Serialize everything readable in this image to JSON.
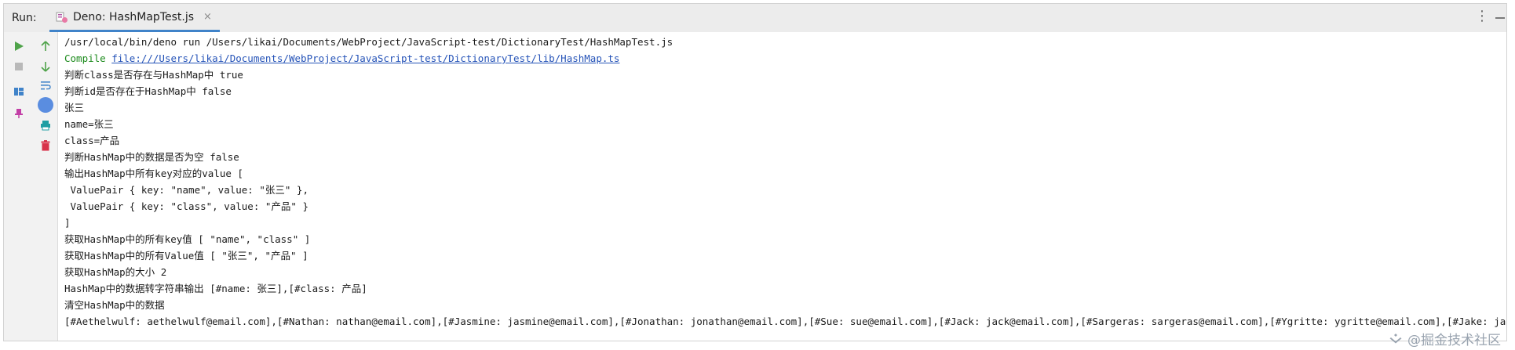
{
  "run_panel": {
    "label": "Run:",
    "tab_title": "Deno: HashMapTest.js",
    "tab_close": "×",
    "more_menu": "⋮"
  },
  "toolbar": {
    "left": [
      "run-icon",
      "stop-icon",
      "layout-icon",
      "pin-icon"
    ],
    "right": [
      "up-arrow-icon",
      "down-arrow-icon",
      "soft-wrap-icon",
      "scroll-to-end-icon",
      "print-icon",
      "trash-icon"
    ]
  },
  "console": {
    "command": "/usr/local/bin/deno run /Users/likai/Documents/WebProject/JavaScript-test/DictionaryTest/HashMapTest.js",
    "compile_prefix": "Compile ",
    "compile_link": "file:///Users/likai/Documents/WebProject/JavaScript-test/DictionaryTest/lib/HashMap.ts",
    "lines": [
      "判断class是否存在与HashMap中 true",
      "判断id是否存在于HashMap中 false",
      "张三",
      "name=张三",
      "class=产品",
      "判断HashMap中的数据是否为空 false",
      "输出HashMap中所有key对应的value [",
      " ValuePair { key: \"name\", value: \"张三\" },",
      " ValuePair { key: \"class\", value: \"产品\" }",
      "]",
      "获取HashMap中的所有key值 [ \"name\", \"class\" ]",
      "获取HashMap中的所有Value值 [ \"张三\", \"产品\" ]",
      "获取HashMap的大小 2",
      "HashMap中的数据转字符串输出 [#name: 张三],[#class: 产品]",
      "清空HashMap中的数据",
      "[#Aethelwulf: aethelwulf@email.com],[#Nathan: nathan@email.com],[#Jasmine: jasmine@email.com],[#Jonathan: jonathan@email.com],[#Sue: sue@email.com],[#Jack: jack@email.com],[#Sargeras: sargeras@email.com],[#Ygritte: ygritte@email.com],[#Jake: jake@email.com],[#Ath"
    ]
  },
  "watermark": "@掘金技术社区",
  "colors": {
    "run_green": "#4fa34a",
    "accent_blue": "#4083c9",
    "print_teal": "#1f9ea3",
    "trash_red": "#d8324a",
    "pin_magenta": "#c23fa6",
    "compile_green": "#1b8a1b",
    "link_blue": "#2553b8"
  }
}
